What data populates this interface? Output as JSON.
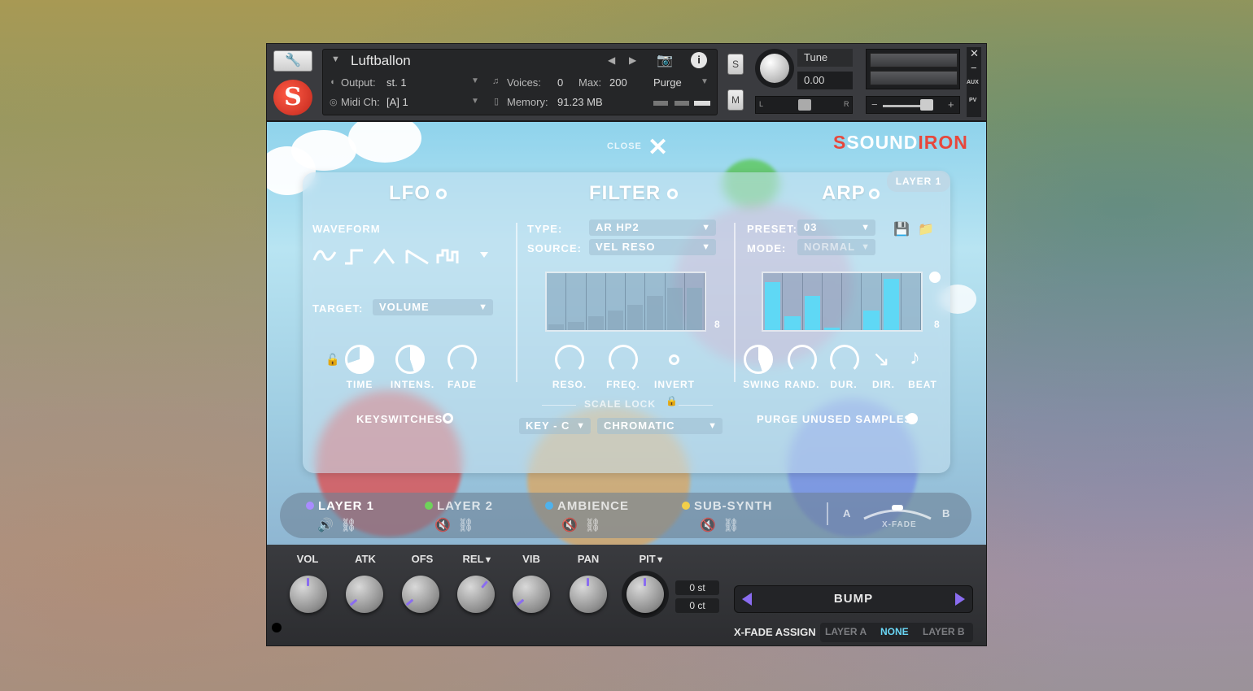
{
  "header": {
    "instrument_name": "Luftballon",
    "output_label": "Output:",
    "output_value": "st. 1",
    "midi_label": "Midi Ch:",
    "midi_value": "[A]  1",
    "voices_label": "Voices:",
    "voices_value": "0",
    "max_label": "Max:",
    "max_value": "200",
    "memory_label": "Memory:",
    "memory_value": "91.23 MB",
    "purge_label": "Purge",
    "s_button": "S",
    "m_button": "M",
    "tune_label": "Tune",
    "tune_value": "0.00",
    "pan_left": "L",
    "pan_right": "R",
    "aux_label": "AUX",
    "pv_label": "PV"
  },
  "main": {
    "close_label": "CLOSE",
    "brand": {
      "part1": "S",
      "part2": "SOUND",
      "part3": "IRON"
    },
    "layer_badge": "LAYER 1",
    "lfo": {
      "title": "LFO",
      "waveform_label": "WAVEFORM",
      "target_label": "TARGET:",
      "target_value": "VOLUME",
      "knobs": [
        "TIME",
        "INTENS.",
        "FADE"
      ],
      "keyswitches_label": "KEYSWITCHES"
    },
    "filter": {
      "title": "FILTER",
      "type_label": "TYPE:",
      "type_value": "AR HP2",
      "source_label": "SOURCE:",
      "source_value": "VEL RESO",
      "steps": "8",
      "knobs": [
        "RESO.",
        "FREQ.",
        "INVERT"
      ],
      "scale_lock_label": "SCALE LOCK",
      "key_value": "KEY - C",
      "scale_value": "CHROMATIC"
    },
    "arp": {
      "title": "ARP",
      "preset_label": "PRESET:",
      "preset_value": "03",
      "mode_label": "MODE:",
      "mode_value": "NORMAL",
      "steps": "8",
      "knobs": [
        "SWING",
        "RAND.",
        "DUR.",
        "DIR.",
        "BEAT"
      ],
      "purge_label": "PURGE UNUSED SAMPLES"
    },
    "layers": [
      {
        "name": "LAYER 1",
        "color": "#a98cff"
      },
      {
        "name": "LAYER 2",
        "color": "#6fd35a"
      },
      {
        "name": "AMBIENCE",
        "color": "#4fb2ec"
      },
      {
        "name": "SUB-SYNTH",
        "color": "#f2cf4a"
      }
    ],
    "xfade": {
      "a": "A",
      "label": "X-FADE",
      "b": "B"
    }
  },
  "bottom": {
    "knobs": [
      "VOL",
      "ATK",
      "OFS",
      "REL",
      "VIB",
      "PAN",
      "PIT"
    ],
    "semitones": "0 st",
    "cents": "0 ct",
    "preset_name": "BUMP",
    "xfade_assign_label": "X-FADE ASSIGN",
    "xfade_options": [
      "LAYER A",
      "NONE",
      "LAYER B"
    ],
    "xfade_selected": "NONE"
  },
  "colors": {
    "accent": "#8a6cf0",
    "brand_red": "#e7473c",
    "panel_bg": "#2c2d30"
  },
  "filter_seq": [
    0.1,
    0.15,
    0.25,
    0.35,
    0.45,
    0.6,
    0.75,
    0.75
  ],
  "arp_seq": [
    0.85,
    0.25,
    0.6,
    0.05,
    0,
    0.35,
    0.9,
    0
  ]
}
